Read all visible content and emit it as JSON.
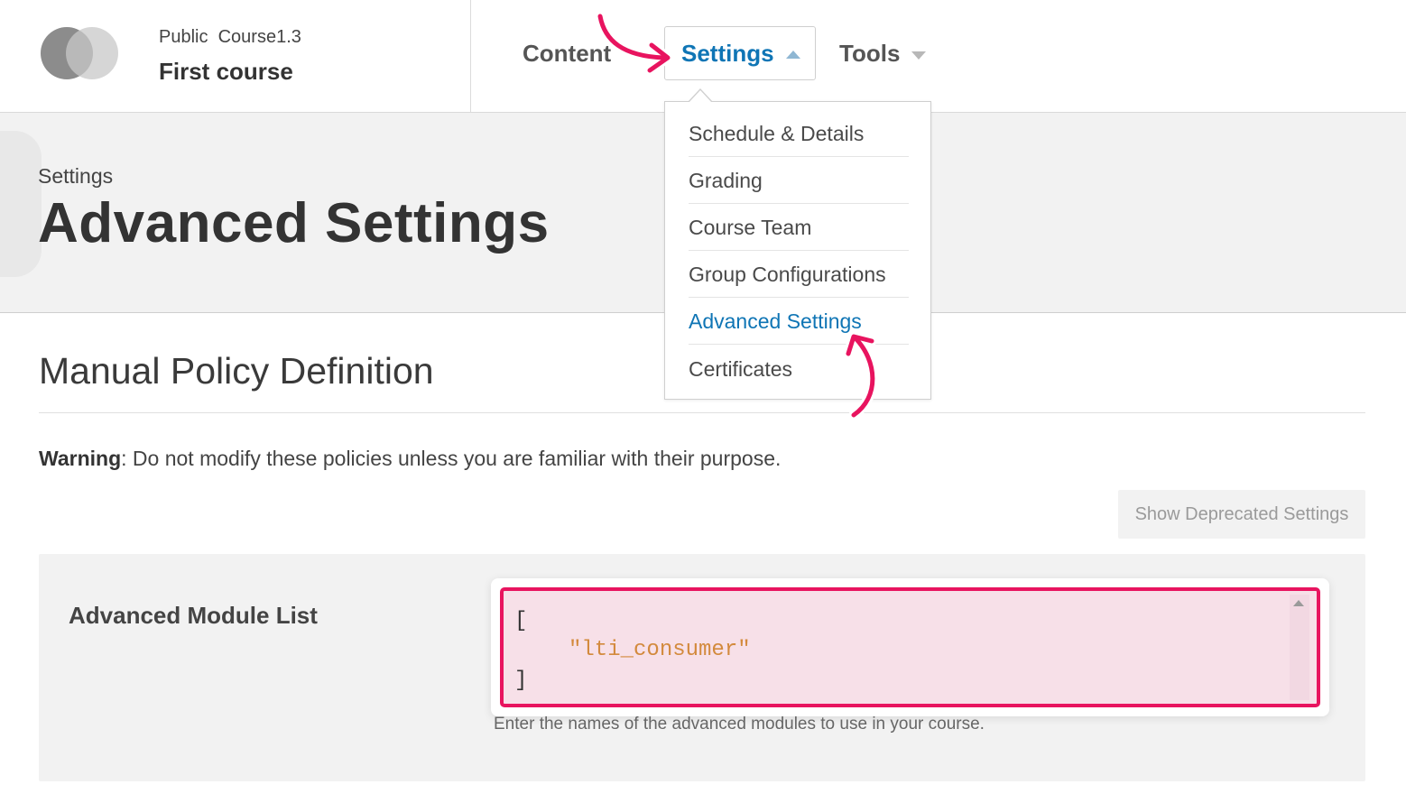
{
  "header": {
    "org_label": "Public",
    "course_number": "Course1.3",
    "course_name": "First course"
  },
  "nav": {
    "content_label": "Content",
    "settings_label": "Settings",
    "tools_label": "Tools"
  },
  "settings_menu": {
    "items": [
      {
        "label": "Schedule & Details"
      },
      {
        "label": "Grading"
      },
      {
        "label": "Course Team"
      },
      {
        "label": "Group Configurations"
      },
      {
        "label": "Advanced Settings"
      },
      {
        "label": "Certificates"
      }
    ],
    "active_index": 4
  },
  "page": {
    "breadcrumb": "Settings",
    "title": "Advanced Settings"
  },
  "policy": {
    "section_title": "Manual Policy Definition",
    "warning_strong": "Warning",
    "warning_text": ": Do not modify these policies unless you are familiar with their purpose.",
    "deprecated_button": "Show Deprecated Settings",
    "field_label": "Advanced Module List",
    "code": {
      "open": "[",
      "value": "\"lti_consumer\"",
      "close": "]"
    },
    "help_text": "Enter the names of the advanced modules to use in your course."
  },
  "colors": {
    "accent_blue": "#0f75b5",
    "highlight_pink": "#e8145f",
    "string_orange": "#d38a3d"
  }
}
